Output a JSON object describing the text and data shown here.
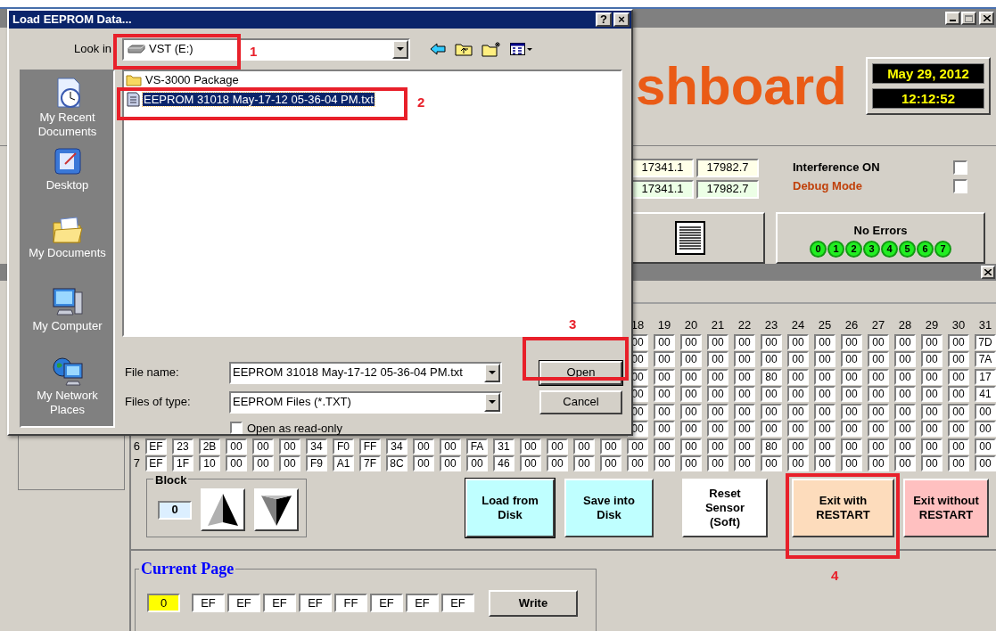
{
  "dialog": {
    "title": "Load EEPROM Data...",
    "title_buttons": [
      "?",
      "×"
    ],
    "look_in": {
      "label": "Look in",
      "value": "VST (E:)"
    },
    "places": [
      {
        "label": "My Recent Documents",
        "kind": "recent"
      },
      {
        "label": "Desktop",
        "kind": "desktop"
      },
      {
        "label": "My Documents",
        "kind": "documents"
      },
      {
        "label": "My Computer",
        "kind": "computer"
      },
      {
        "label": "My Network Places",
        "kind": "network"
      }
    ],
    "files": [
      {
        "name": "VS-3000 Package",
        "kind": "folder",
        "selected": false
      },
      {
        "name": "EEPROM 31018 May-17-12 05-36-04 PM.txt",
        "kind": "file",
        "selected": true
      }
    ],
    "file_name": {
      "label": "File name:",
      "value": "EEPROM 31018 May-17-12 05-36-04 PM.txt"
    },
    "file_type": {
      "label": "Files of type:",
      "value": "EEPROM Files (*.TXT)"
    },
    "buttons": [
      "Open",
      "Cancel"
    ],
    "read_only": {
      "label": "Open as read-only",
      "checked": false
    }
  },
  "app": {
    "logo": "shboard",
    "date": "May 29, 2012",
    "time": "12:12:52",
    "readings": [
      {
        "values": [
          "17341.1",
          "17982.7"
        ],
        "color": "#ffffe8"
      },
      {
        "values": [
          "17341.1",
          "17982.7"
        ],
        "color": "#ecffe6"
      }
    ],
    "options": [
      {
        "label": "Interference ON",
        "checked": false,
        "color": "#000000"
      },
      {
        "label": "Debug Mode",
        "checked": false,
        "color": "#c0400a"
      }
    ],
    "status": "No Errors",
    "indicators": [
      "0",
      "1",
      "2",
      "3",
      "4",
      "5",
      "6",
      "7"
    ],
    "grid": {
      "columns": [
        "18",
        "19",
        "20",
        "21",
        "22",
        "23",
        "24",
        "25",
        "26",
        "27",
        "28",
        "29",
        "30",
        "31"
      ],
      "rows": [
        {
          "cells": [
            "00",
            "00",
            "00",
            "00",
            "00",
            "00",
            "00",
            "00",
            "00",
            "00",
            "00",
            "00",
            "00",
            "7D"
          ]
        },
        {
          "cells": [
            "00",
            "00",
            "00",
            "00",
            "00",
            "00",
            "00",
            "00",
            "00",
            "00",
            "00",
            "00",
            "00",
            "7A"
          ]
        },
        {
          "cells": [
            "00",
            "00",
            "00",
            "00",
            "00",
            "80",
            "00",
            "00",
            "00",
            "00",
            "00",
            "00",
            "00",
            "17"
          ]
        },
        {
          "cells": [
            "00",
            "00",
            "00",
            "00",
            "00",
            "00",
            "00",
            "00",
            "00",
            "00",
            "00",
            "00",
            "00",
            "41"
          ]
        },
        {
          "cells": [
            "00",
            "00",
            "00",
            "00",
            "00",
            "00",
            "00",
            "00",
            "00",
            "00",
            "00",
            "00",
            "00",
            "00"
          ]
        },
        {
          "cells": [
            "00",
            "00",
            "00",
            "00",
            "00",
            "00",
            "00",
            "00",
            "00",
            "00",
            "00",
            "00",
            "00",
            "00"
          ]
        },
        {
          "label": "6",
          "cells": [
            "EF",
            "23",
            "2B",
            "00",
            "00",
            "00",
            "34",
            "F0",
            "FF",
            "34",
            "00",
            "00",
            "FA",
            "31",
            "00",
            "00",
            "00",
            "00",
            "00",
            "00",
            "00",
            "00",
            "00",
            "80",
            "00",
            "00",
            "00",
            "00",
            "00",
            "00",
            "00",
            "00"
          ]
        },
        {
          "label": "7",
          "cells": [
            "EF",
            "1F",
            "10",
            "00",
            "00",
            "00",
            "F9",
            "A1",
            "7F",
            "8C",
            "00",
            "00",
            "00",
            "46",
            "00",
            "00",
            "00",
            "00",
            "00",
            "00",
            "00",
            "00",
            "00",
            "00",
            "00",
            "00",
            "00",
            "00",
            "00",
            "00",
            "00",
            "00"
          ]
        }
      ]
    },
    "block": {
      "label": "Block",
      "value": "0"
    },
    "actions": [
      {
        "label": "Load from Disk",
        "color": "#bfffff"
      },
      {
        "label": "Save into Disk",
        "color": "#bfffff"
      },
      {
        "label": "Reset Sensor (Soft)",
        "color": "#ffffff"
      },
      {
        "label": "Exit with RESTART",
        "color": "#fddcbc"
      },
      {
        "label": "Exit without RESTART",
        "color": "#ffc0c0"
      }
    ],
    "current_page": {
      "title": "Current Page",
      "page": "0",
      "bytes": [
        "EF",
        "EF",
        "EF",
        "EF",
        "FF",
        "EF",
        "EF",
        "EF"
      ],
      "button": "Write"
    }
  },
  "annotations": [
    {
      "label": "1"
    },
    {
      "label": "2"
    },
    {
      "label": "3"
    },
    {
      "label": "4"
    }
  ]
}
